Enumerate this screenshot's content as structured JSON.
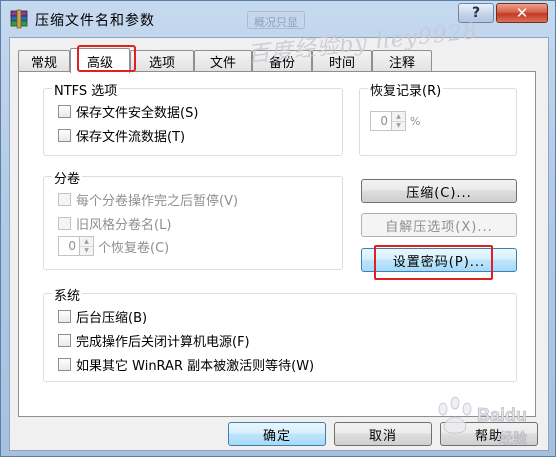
{
  "window": {
    "title": "压缩文件名和参数",
    "ghost_tab_label": "概况只显",
    "help_glyph": "?",
    "close_glyph": "✕"
  },
  "tabs": [
    {
      "label": "常规",
      "active": false
    },
    {
      "label": "高级",
      "active": true
    },
    {
      "label": "选项",
      "active": false
    },
    {
      "label": "文件",
      "active": false
    },
    {
      "label": "备份",
      "active": false
    },
    {
      "label": "时间",
      "active": false
    },
    {
      "label": "注释",
      "active": false
    }
  ],
  "ntfs": {
    "title": "NTFS 选项",
    "options": [
      "保存文件安全数据(S)",
      "保存文件流数据(T)"
    ]
  },
  "recovery": {
    "title": "恢复记录(R)",
    "value": "0",
    "unit": "%"
  },
  "volume": {
    "title": "分卷",
    "options": [
      "每个分卷操作完之后暂停(V)",
      "旧风格分卷名(L)"
    ],
    "spin_value": "0",
    "spin_label": "个恢复卷(C)"
  },
  "side_buttons": {
    "compress": "压缩(C)...",
    "sfx": "自解压选项(X)...",
    "password": "设置密码(P)..."
  },
  "system": {
    "title": "系统",
    "options": [
      "后台压缩(B)",
      "完成操作后关闭计算机电源(F)",
      "如果其它 WinRAR 副本被激活则等待(W)"
    ]
  },
  "footer": {
    "ok": "确定",
    "cancel": "取消",
    "help": "帮助"
  },
  "watermark_text": "百度经验by hey9928",
  "baidu_wm": {
    "brand": "Baidu",
    "sub": "经验"
  },
  "colors": {
    "highlight_red": "#dd2222",
    "accent_blue": "#3c7fb1"
  }
}
